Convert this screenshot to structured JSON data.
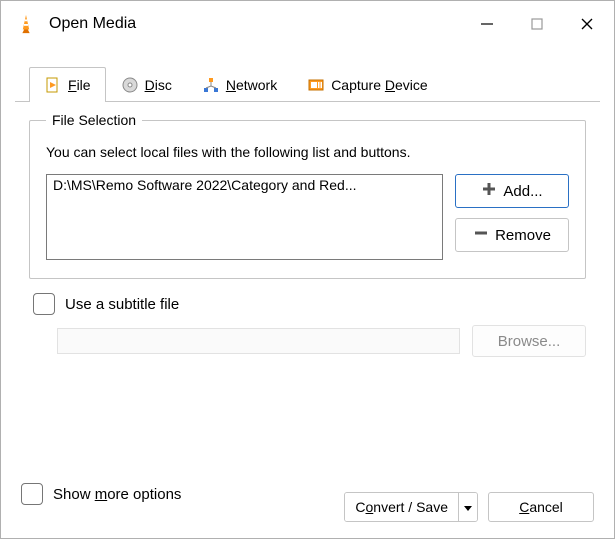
{
  "window": {
    "title": "Open Media"
  },
  "tabs": {
    "file": {
      "prefix": "",
      "shortcut": "F",
      "suffix": "ile"
    },
    "disc": {
      "prefix": "",
      "shortcut": "D",
      "suffix": "isc"
    },
    "network": {
      "prefix": "",
      "shortcut": "N",
      "suffix": "etwork"
    },
    "capture": {
      "prefix": "Capture ",
      "shortcut": "D",
      "suffix": "evice"
    }
  },
  "file_selection": {
    "legend": "File Selection",
    "help": "You can select local files with the following list and buttons.",
    "files": {
      "item0": "D:\\MS\\Remo Software 2022\\Category and Red..."
    },
    "add_label": " Add...",
    "remove_label": " Remove"
  },
  "subtitle": {
    "checkbox_label": "Use a subtitle file",
    "browse_label": "Browse..."
  },
  "more_options": {
    "prefix": "Show ",
    "shortcut": "m",
    "suffix": "ore options"
  },
  "actions": {
    "convert_prefix": "C",
    "convert_shortcut": "o",
    "convert_suffix": "nvert / Save",
    "cancel_prefix": "",
    "cancel_shortcut": "C",
    "cancel_suffix": "ancel"
  }
}
